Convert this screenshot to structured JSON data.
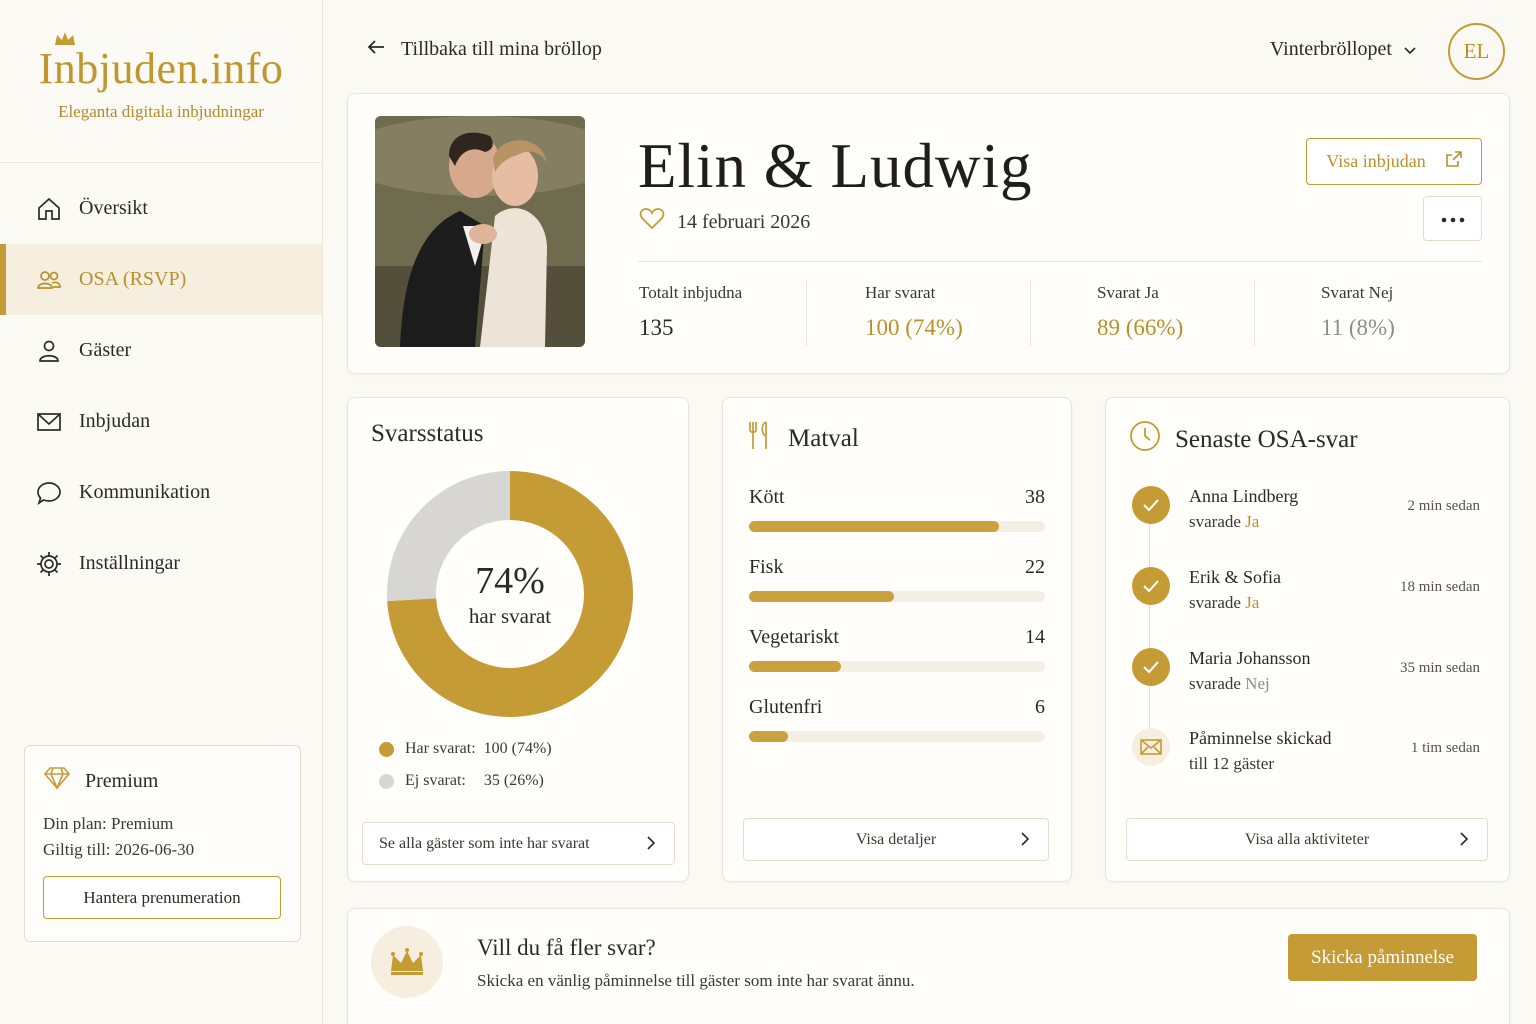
{
  "brand": {
    "name": "Inbjuden.info",
    "tagline": "Eleganta digitala inbjudningar"
  },
  "nav": {
    "items": [
      {
        "label": "Översikt",
        "icon": "home-icon"
      },
      {
        "label": "OSA (RSVP)",
        "icon": "users-icon",
        "active": true
      },
      {
        "label": "Gäster",
        "icon": "user-icon"
      },
      {
        "label": "Inbjudan",
        "icon": "envelope-icon"
      },
      {
        "label": "Kommunikation",
        "icon": "chat-icon"
      },
      {
        "label": "Inställningar",
        "icon": "gear-icon"
      }
    ]
  },
  "premium": {
    "title": "Premium",
    "plan": "Din plan: Premium",
    "valid": "Giltig till: 2026-06-30",
    "manage_label": "Hantera prenumeration"
  },
  "topbar": {
    "back_label": "Tillbaka till mina bröllop",
    "wedding_selected": "Vinterbröllopet",
    "avatar_initials": "EL"
  },
  "hero": {
    "couple": "Elin & Ludwig",
    "date": "14 februari 2026",
    "view_label": "Visa inbjudan",
    "stats": [
      {
        "label": "Totalt inbjudna",
        "value": "135"
      },
      {
        "label": "Har svarat",
        "value": "100 (74%)"
      },
      {
        "label": "Svarat Ja",
        "value": "89 (66%)"
      },
      {
        "label": "Svarat Nej",
        "value": "11 (8%)"
      }
    ]
  },
  "svarsstatus": {
    "title": "Svarsstatus",
    "center_value": "74%",
    "center_label": "har svarat",
    "legend": [
      {
        "label": "Har svarat:",
        "value": "100 (74%)"
      },
      {
        "label": "Ej svarat:",
        "value": "35 (26%)"
      }
    ],
    "button_label": "Se alla gäster som inte har svarat"
  },
  "chart_data": {
    "type": "pie",
    "categories": [
      "Har svarat",
      "Ej svarat"
    ],
    "values": [
      100,
      35
    ],
    "percent": [
      74,
      26
    ]
  },
  "matval": {
    "title": "Matval",
    "max": 45,
    "items": [
      {
        "label": "Kött",
        "value": 38
      },
      {
        "label": "Fisk",
        "value": 22
      },
      {
        "label": "Vegetariskt",
        "value": 14
      },
      {
        "label": "Glutenfri",
        "value": 6
      }
    ],
    "button_label": "Visa detaljer"
  },
  "senaste": {
    "title": "Senaste OSA-svar",
    "items": [
      {
        "name": "Anna Lindberg",
        "prefix": "svarade",
        "answer": "Ja",
        "time": "2 min sedan"
      },
      {
        "name": "Erik & Sofia",
        "prefix": "svarade",
        "answer": "Ja",
        "time": "18 min sedan"
      },
      {
        "name": "Maria Johansson",
        "prefix": "svarade",
        "answer": "Nej",
        "time": "35 min sedan"
      },
      {
        "name": "Påminnelse skickad",
        "prefix": "till 12 gäster",
        "answer": "",
        "time": "1 tim sedan"
      }
    ],
    "button_label": "Visa alla aktiviteter"
  },
  "cta": {
    "title": "Vill du få fler svar?",
    "subtitle": "Skicka en vänlig påminnelse till gäster som inte har svarat ännu.",
    "button_label": "Skicka påminnelse"
  },
  "colors": {
    "gold": "#c59b35",
    "grey": "#d8d6d2",
    "muted": "#8f8d88"
  }
}
